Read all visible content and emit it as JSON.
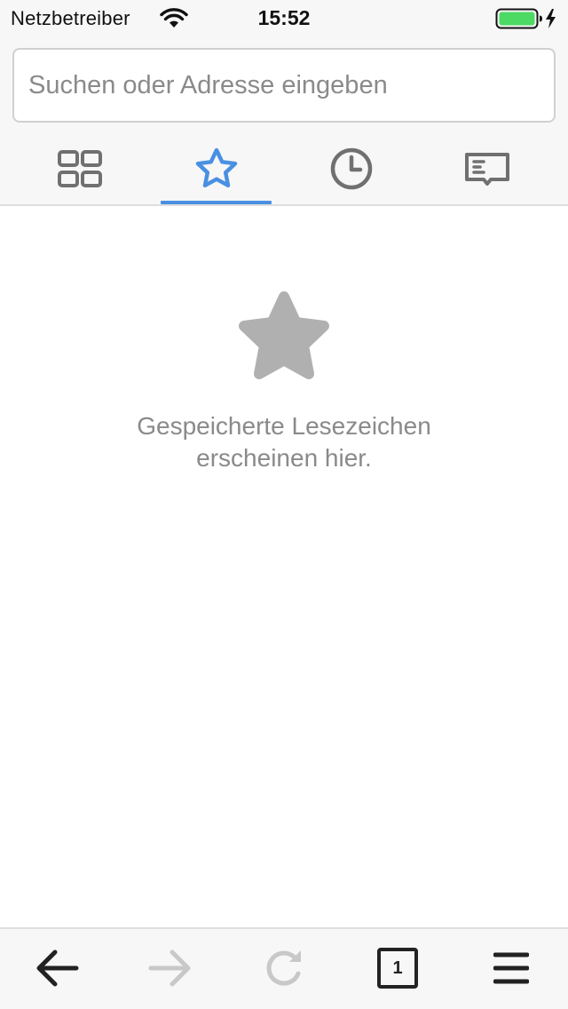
{
  "status_bar": {
    "carrier": "Netzbetreiber",
    "time": "15:52",
    "battery_color": "#4cd964"
  },
  "search": {
    "placeholder": "Suchen oder Adresse eingeben",
    "value": ""
  },
  "tabs": [
    {
      "icon": "top-sites-grid-icon",
      "selected": false
    },
    {
      "icon": "bookmarks-star-icon",
      "selected": true
    },
    {
      "icon": "history-clock-icon",
      "selected": false
    },
    {
      "icon": "reading-list-book-icon",
      "selected": false
    }
  ],
  "empty_state": {
    "icon": "star-icon",
    "message": "Gespeicherte Lesezeichen erscheinen hier."
  },
  "toolbar": {
    "tab_count": "1",
    "items": [
      {
        "icon": "back-arrow-icon",
        "enabled": true
      },
      {
        "icon": "forward-arrow-icon",
        "enabled": false
      },
      {
        "icon": "reload-icon",
        "enabled": false
      },
      {
        "icon": "tabs-counter-icon",
        "enabled": true
      },
      {
        "icon": "menu-icon",
        "enabled": true
      }
    ]
  },
  "colors": {
    "accent": "#4a90e2",
    "icon_gray": "#707070",
    "empty_gray": "#b0b0b0",
    "disabled": "#c8c8c8"
  }
}
